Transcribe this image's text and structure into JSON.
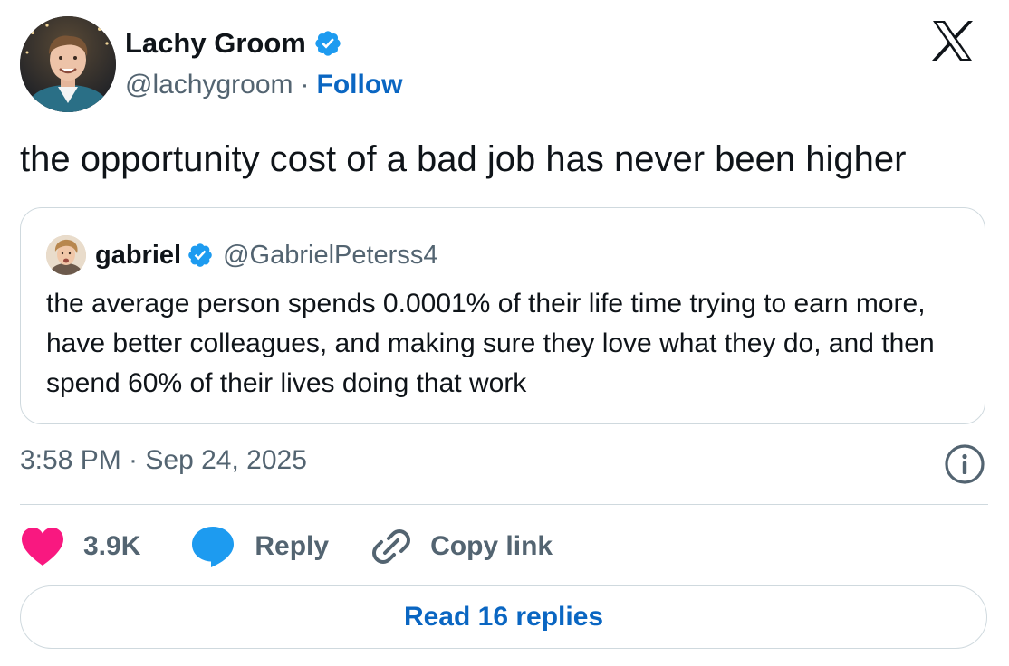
{
  "author": {
    "name": "Lachy Groom",
    "handle": "@lachygroom",
    "separator": "·",
    "follow_label": "Follow",
    "verified": true
  },
  "tweet": {
    "text": "the opportunity cost of a bad job has never been higher",
    "timestamp": "3:58 PM · Sep 24, 2025"
  },
  "quoted_tweet": {
    "name": "gabriel",
    "handle": "@GabrielPeterss4",
    "verified": true,
    "text": "the average person spends 0.0001% of their life time trying to earn more, have better colleagues, and making sure they love what they do, and then spend 60% of their lives doing that work"
  },
  "actions": {
    "like_count": "3.9K",
    "reply_label": "Reply",
    "copy_link_label": "Copy link"
  },
  "read_replies_label": "Read 16 replies",
  "icons": {
    "brand": "x-logo-icon",
    "verified": "verified-badge-icon",
    "info": "info-icon",
    "like": "heart-icon",
    "reply": "speech-bubble-icon",
    "copy_link": "link-icon"
  },
  "colors": {
    "like": "#f91880",
    "reply": "#1d9bf0",
    "verified": "#1d9bf0",
    "link": "#0a66c2",
    "secondary_text": "#536471",
    "border": "#cfd9de"
  }
}
